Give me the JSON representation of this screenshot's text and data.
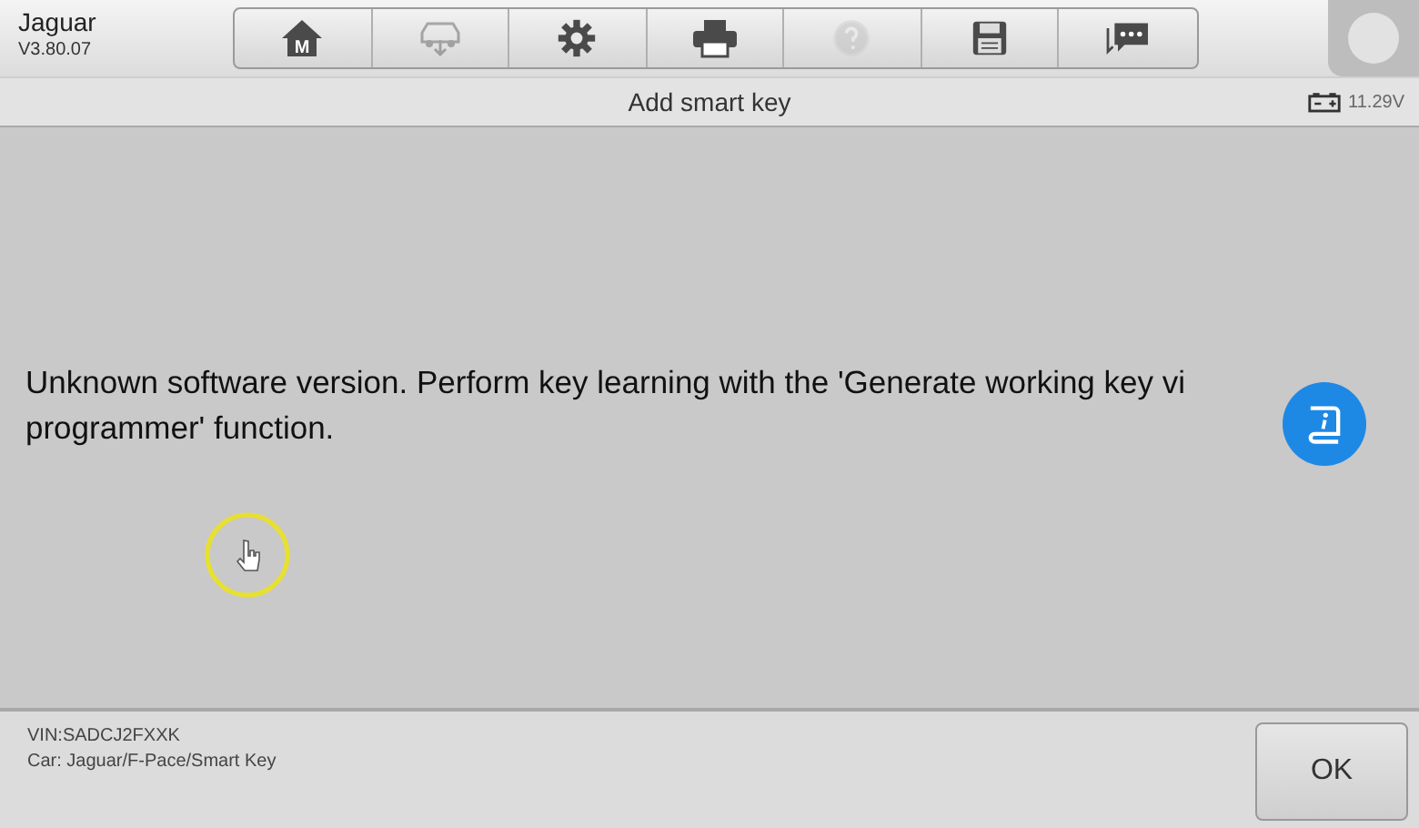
{
  "header": {
    "title": "Jaguar",
    "version": "V3.80.07"
  },
  "toolbar": [
    {
      "kind": "home",
      "label": "M",
      "disabled": false
    },
    {
      "kind": "car",
      "disabled": true
    },
    {
      "kind": "settings",
      "disabled": false
    },
    {
      "kind": "print",
      "disabled": false
    },
    {
      "kind": "help",
      "disabled": true
    },
    {
      "kind": "save",
      "disabled": false
    },
    {
      "kind": "chat",
      "disabled": false
    }
  ],
  "title_bar": {
    "title": "Add smart key",
    "voltage": "11.29V"
  },
  "message": "Unknown software version. Perform key learning with the 'Generate working key vi\nprogrammer' function.",
  "footer": {
    "vin": "VIN:SADCJ2FXXK",
    "car": "Car: Jaguar/F-Pace/Smart Key",
    "buttons": [
      "OK"
    ]
  }
}
